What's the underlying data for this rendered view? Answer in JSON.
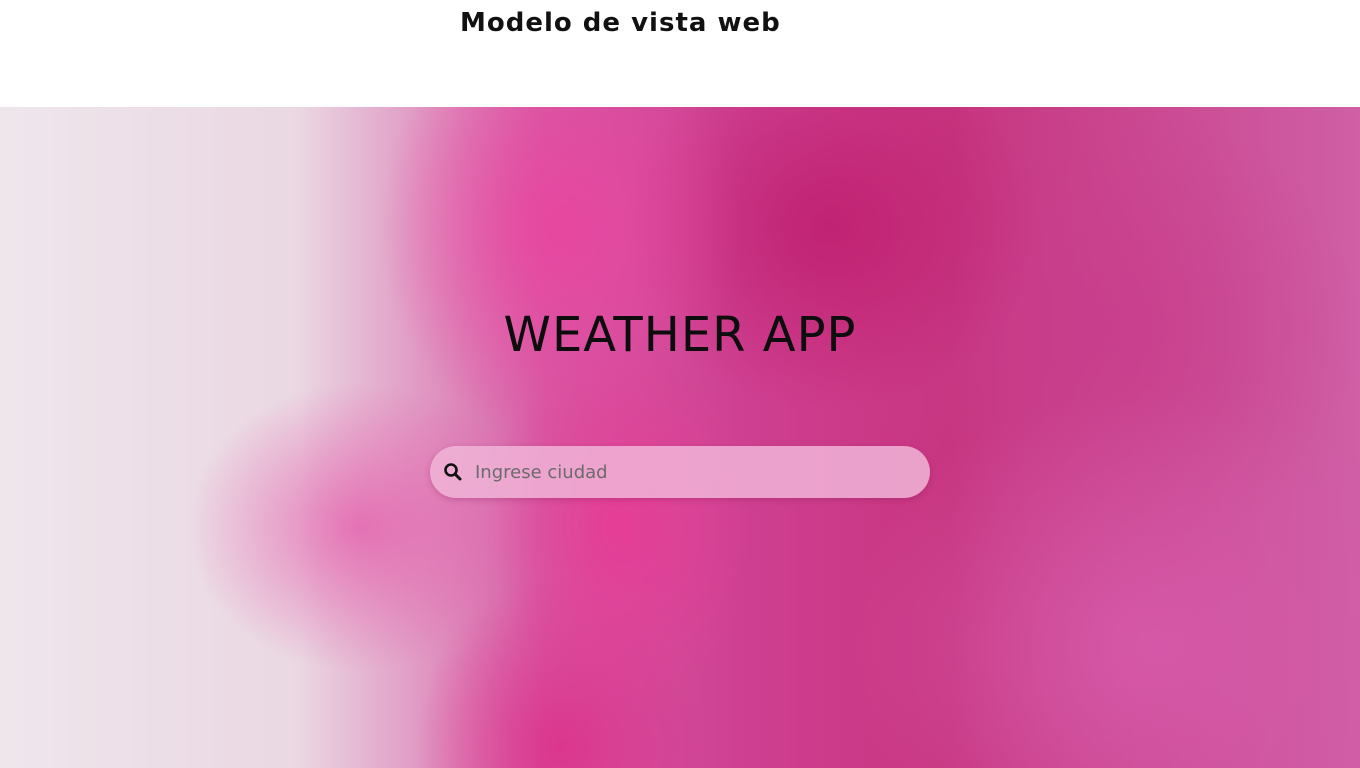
{
  "header": {
    "title": "Modelo de vista web"
  },
  "hero": {
    "title": "WEATHER APP",
    "search": {
      "icon": "search-icon",
      "placeholder": "Ingrese ciudad",
      "value": ""
    }
  },
  "colors": {
    "header_background": "#ffffff",
    "title_text": "#0d0d0d",
    "accent_pink": "#d63f94",
    "search_background": "#f0b4d7"
  }
}
